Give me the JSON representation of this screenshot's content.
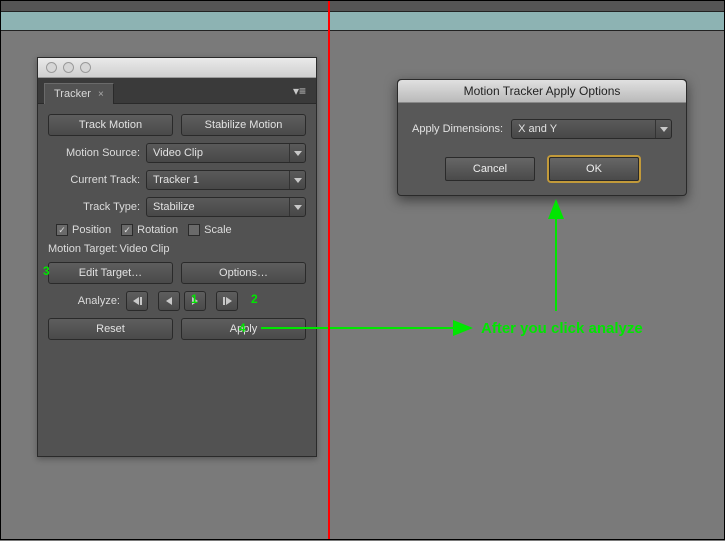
{
  "tracker_panel": {
    "tab_label": "Tracker",
    "track_motion_btn": "Track Motion",
    "stabilize_motion_btn": "Stabilize Motion",
    "motion_source_label": "Motion Source:",
    "motion_source_value": "Video Clip",
    "current_track_label": "Current Track:",
    "current_track_value": "Tracker 1",
    "track_type_label": "Track Type:",
    "track_type_value": "Stabilize",
    "position_label": "Position",
    "rotation_label": "Rotation",
    "scale_label": "Scale",
    "motion_target_label": "Motion Target:",
    "motion_target_value": "Video Clip",
    "edit_target_btn": "Edit Target…",
    "options_btn": "Options…",
    "analyze_label": "Analyze:",
    "reset_btn": "Reset",
    "apply_btn": "Apply"
  },
  "dialog": {
    "title": "Motion Tracker Apply Options",
    "apply_dimensions_label": "Apply Dimensions:",
    "apply_dimensions_value": "X and Y",
    "cancel_btn": "Cancel",
    "ok_btn": "OK"
  },
  "annotations": {
    "n1": "1",
    "n2": "2",
    "n3": "3",
    "n4": "4",
    "after_text": "After you click analyze"
  }
}
